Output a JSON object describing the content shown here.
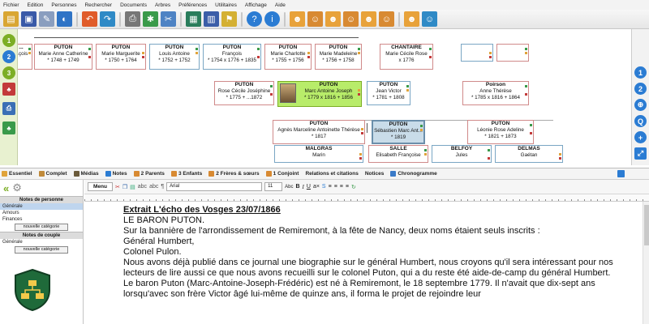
{
  "menu": [
    "Fichier",
    "Edition",
    "Personnes",
    "Rechercher",
    "Documents",
    "Arbres",
    "Préférences",
    "Utilitaires",
    "Affichage",
    "Aide"
  ],
  "toolbar": {
    "buttons": [
      "folder-icon",
      "save-icon",
      "edit-icon",
      "add-icon",
      "undo-icon",
      "redo-icon",
      "print-icon",
      "settings-icon",
      "grid-icon",
      "chart-icon",
      "help-icon",
      "info-icon",
      "person-icon",
      "family-icon",
      "person-add-icon",
      "person-link-icon",
      "person-remove-icon",
      "person-up-icon",
      "persons-icon",
      "couple-icon"
    ],
    "colors": {
      "accent": "#2b7cd3",
      "brand": "#7cae25"
    }
  },
  "left_tools": [
    "1",
    "2",
    "3"
  ],
  "tree": {
    "generation_top": [
      {
        "label": "...",
        "name": "...çois",
        "dates": ""
      },
      {
        "label": "PUTON",
        "name": "Marie Anne Catherine",
        "dates": "* 1748   + 1749"
      },
      {
        "label": "PUTON",
        "name": "Marie Marguerite",
        "dates": "* 1750   + 1764"
      },
      {
        "label": "PUTON",
        "name": "Louis Antoine",
        "dates": "* 1752   + 1752"
      },
      {
        "label": "PUTON",
        "name": "François",
        "dates": "* 1754   x 1776   + 1835"
      },
      {
        "label": "PUTON",
        "name": "Marie Charlotte",
        "dates": "* 1755   + 1756"
      },
      {
        "label": "PUTON",
        "name": "Marie Madeleine",
        "dates": "* 1756   + 1758"
      },
      {
        "label": "CHANTAIRE",
        "name": "Marie Cécile Rose",
        "dates": "x 1776"
      }
    ],
    "generation_mid": [
      {
        "label": "PUTON",
        "name": "Rose Cécile Joséphine",
        "dates": "* 1775   + ...1872"
      },
      {
        "label": "PUTON",
        "name": "Marc Antoine Joseph",
        "dates": "* 1779   x 1816   + 1856"
      },
      {
        "label": "PUTON",
        "name": "Jean Victor",
        "dates": "* 1781   + 1808"
      },
      {
        "label": "Poirson",
        "name": "Anne Thérèse",
        "dates": "* 1785   x 1816   + 1864"
      }
    ],
    "generation_low": [
      {
        "label": "PUTON",
        "name": "Agnès Marceline Antoinette Thérèse",
        "dates": "* 1817"
      },
      {
        "label": "PUTON",
        "name": "Sébastien Marc Ant...",
        "dates": "* 1819"
      },
      {
        "label": "PUTON",
        "name": "Léonie Rose Adeline",
        "dates": "* 1821   + 1873"
      }
    ],
    "generation_bottom": [
      {
        "label": "MALGRAS",
        "name": "Marin"
      },
      {
        "label": "SALLE",
        "name": "Elisabeth Françoise"
      },
      {
        "label": "BELFOY",
        "name": "Jules"
      },
      {
        "label": "DELMAS",
        "name": "Gaétan"
      }
    ]
  },
  "right_tools": [
    "1",
    "2",
    "⊕",
    "Q",
    "+",
    "⤢"
  ],
  "tabs": [
    {
      "label": "Essentiel",
      "icon": "note-icon"
    },
    {
      "label": "Complet",
      "icon": "doc-icon"
    },
    {
      "label": "Médias",
      "icon": "media-icon"
    },
    {
      "label": "Notes",
      "icon": "pin-icon"
    },
    {
      "label": "2 Parents",
      "icon": "parents-icon"
    },
    {
      "label": "3 Enfants",
      "icon": "children-icon"
    },
    {
      "label": "2 Frères & sœurs",
      "icon": "siblings-icon"
    },
    {
      "label": "1 Conjoint",
      "icon": "spouse-icon"
    },
    {
      "label": "Relations et citations",
      "icon": ""
    },
    {
      "label": "Notices",
      "icon": ""
    },
    {
      "label": "Chronogramme",
      "icon": "chrono-icon"
    }
  ],
  "notes_panel": {
    "person_header": "Notes de personne",
    "person_categories": [
      "Générale",
      "Amours",
      "Finances"
    ],
    "new_category": "nouvelle catégorie",
    "couple_header": "Notes de couple",
    "couple_categories": [
      "Générale"
    ]
  },
  "editor": {
    "menu_label": "Menu",
    "font": "Arial",
    "size": "11",
    "title": "Extrait L'écho des Vosges 23/07/1866",
    "paragraphs": [
      "LE BARON PUTON.",
      "Sur la bannière de l'arrondissement de Remiremont, à la fête de Nancy, deux noms étaient seuls inscrits :",
      "Général Humbert,",
      "Colonel Pulon.",
      "Nous avons déjà publié dans ce journal une biographie sur le général Humbert, nous croyons qu'il sera intéressant pour nos lecteurs de lire aussi ce que nous avons recueilli sur le colonel Puton, qui a du reste été aide-de-camp du général Humbert.",
      "Le baron Puton (Marc-Antoine-Joseph-Frédéric) est né à Remiremont, le 18 septembre 1779. Il n'avait que dix-sept ans lorsqu'avec son frère Victor âgé lui-même de quinze ans, il forma le projet de rejoindre leur"
    ]
  }
}
